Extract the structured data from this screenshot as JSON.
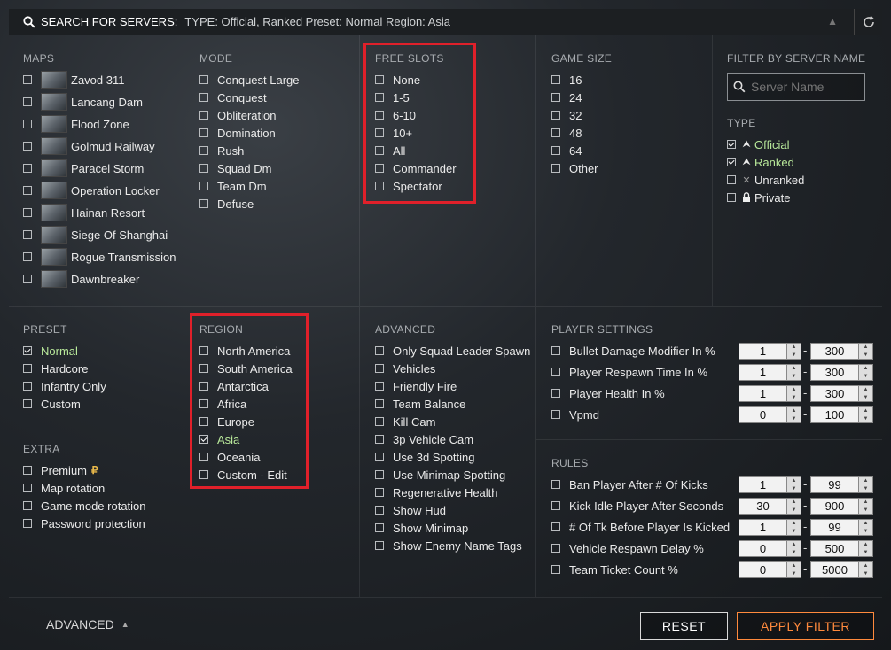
{
  "topbar": {
    "label": "SEARCH FOR SERVERS:",
    "criteria": "TYPE: Official, Ranked  Preset: Normal  Region: Asia"
  },
  "maps": {
    "title": "MAPS",
    "items": [
      "Zavod 311",
      "Lancang Dam",
      "Flood Zone",
      "Golmud Railway",
      "Paracel Storm",
      "Operation Locker",
      "Hainan Resort",
      "Siege Of Shanghai",
      "Rogue Transmission",
      "Dawnbreaker"
    ]
  },
  "mode": {
    "title": "MODE",
    "items": [
      "Conquest Large",
      "Conquest",
      "Obliteration",
      "Domination",
      "Rush",
      "Squad Dm",
      "Team Dm",
      "Defuse"
    ]
  },
  "free_slots": {
    "title": "FREE SLOTS",
    "items": [
      "None",
      "1-5",
      "6-10",
      "10+",
      "All",
      "Commander",
      "Spectator"
    ]
  },
  "game_size": {
    "title": "GAME SIZE",
    "items": [
      "16",
      "24",
      "32",
      "48",
      "64",
      "Other"
    ]
  },
  "filter_name": {
    "title": "FILTER BY SERVER NAME",
    "placeholder": "Server Name"
  },
  "type": {
    "title": "TYPE",
    "items": [
      {
        "label": "Official",
        "checked": true
      },
      {
        "label": "Ranked",
        "checked": true
      },
      {
        "label": "Unranked",
        "checked": false
      },
      {
        "label": "Private",
        "checked": false
      }
    ]
  },
  "preset": {
    "title": "PRESET",
    "items": [
      {
        "label": "Normal",
        "checked": true
      },
      {
        "label": "Hardcore",
        "checked": false
      },
      {
        "label": "Infantry Only",
        "checked": false
      },
      {
        "label": "Custom",
        "checked": false
      }
    ]
  },
  "extra": {
    "title": "EXTRA",
    "items": [
      "Premium",
      "Map rotation",
      "Game mode rotation",
      "Password protection"
    ]
  },
  "region": {
    "title": "REGION",
    "items": [
      {
        "label": "North America",
        "checked": false
      },
      {
        "label": "South America",
        "checked": false
      },
      {
        "label": "Antarctica",
        "checked": false
      },
      {
        "label": "Africa",
        "checked": false
      },
      {
        "label": "Europe",
        "checked": false
      },
      {
        "label": "Asia",
        "checked": true
      },
      {
        "label": "Oceania",
        "checked": false
      },
      {
        "label": "Custom - Edit",
        "checked": false
      }
    ]
  },
  "advanced": {
    "title": "ADVANCED",
    "items": [
      "Only Squad Leader Spawn",
      "Vehicles",
      "Friendly Fire",
      "Team Balance",
      "Kill Cam",
      "3p Vehicle Cam",
      "Use 3d Spotting",
      "Use Minimap Spotting",
      "Regenerative Health",
      "Show Hud",
      "Show Minimap",
      "Show Enemy Name Tags"
    ]
  },
  "player_settings": {
    "title": "PLAYER SETTINGS",
    "items": [
      {
        "label": "Bullet Damage Modifier In %",
        "min": "1",
        "max": "300"
      },
      {
        "label": "Player Respawn Time In %",
        "min": "1",
        "max": "300"
      },
      {
        "label": "Player Health In %",
        "min": "1",
        "max": "300"
      },
      {
        "label": "Vpmd",
        "min": "0",
        "max": "100"
      }
    ]
  },
  "rules": {
    "title": "RULES",
    "items": [
      {
        "label": "Ban Player After # Of Kicks",
        "min": "1",
        "max": "99"
      },
      {
        "label": "Kick Idle Player After Seconds",
        "min": "30",
        "max": "900"
      },
      {
        "label": "# Of Tk Before Player Is Kicked",
        "min": "1",
        "max": "99"
      },
      {
        "label": "Vehicle Respawn Delay %",
        "min": "0",
        "max": "500"
      },
      {
        "label": "Team Ticket Count %",
        "min": "0",
        "max": "5000"
      }
    ]
  },
  "footer": {
    "advanced_toggle": "ADVANCED",
    "reset": "RESET",
    "apply": "APPLY FILTER"
  },
  "colors": {
    "accent_orange": "#ff8a3d",
    "highlight_green": "#b8e89a",
    "annotation_red": "#e0202a"
  }
}
